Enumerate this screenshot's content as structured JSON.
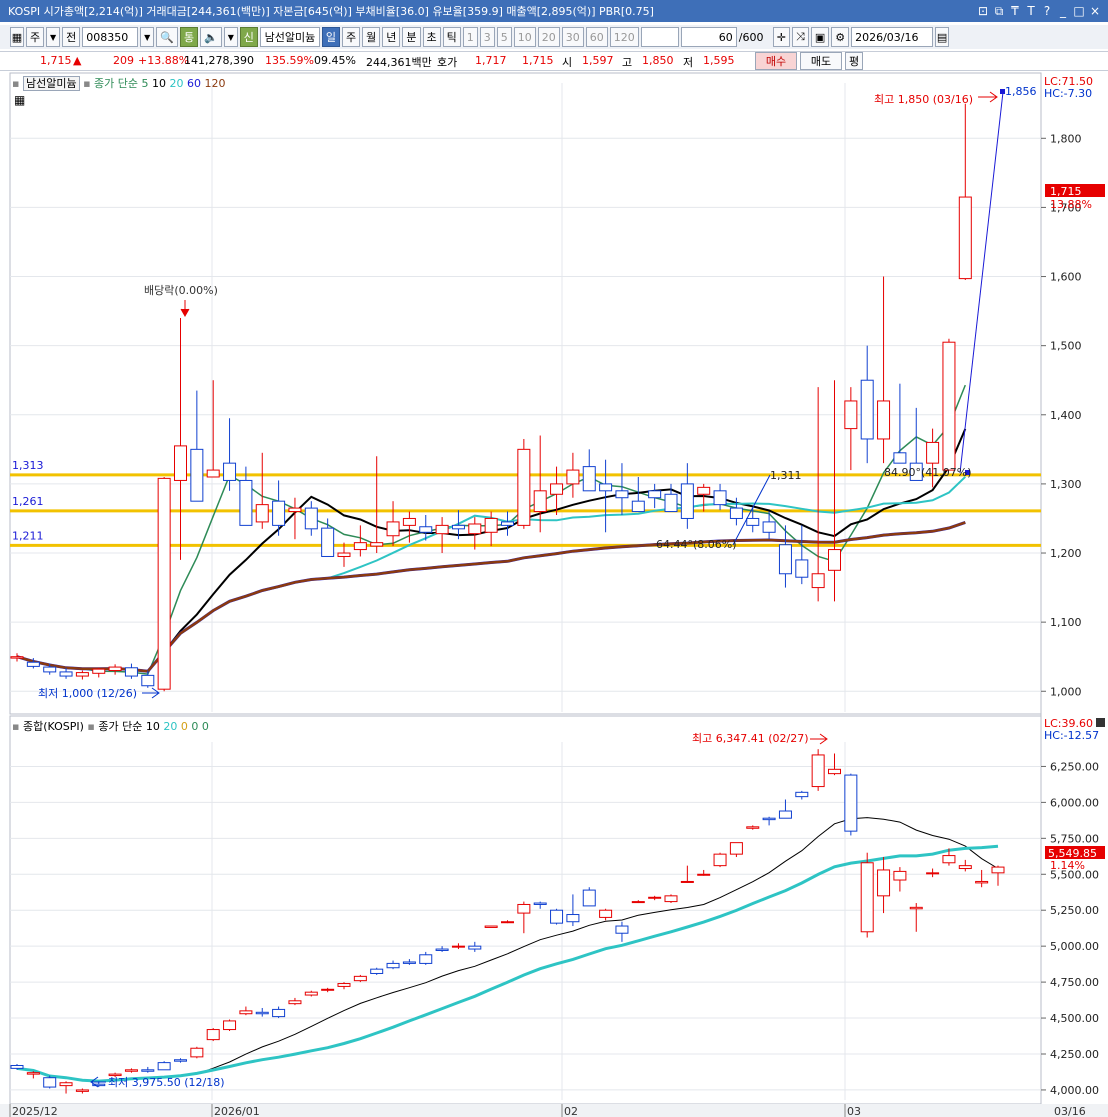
{
  "window": {
    "title": "KOSPI 시가총액[2,214(억)] 거래대금[244,361(백만)] 자본금[645(억)] 부채비율[36.0] 유보율[359.9] 매출액[2,895(억)] PBR[0.75]",
    "buttons": [
      "⊡",
      "⧉",
      "₸",
      "T",
      "?",
      "_",
      "□",
      "×"
    ]
  },
  "toolbar": {
    "market": "주",
    "scope": "전",
    "code": "008350",
    "search_icon": "🔍",
    "tong": "통",
    "sound_icon": "🔈",
    "sin": "신",
    "stock_name": "남선알미늄",
    "periods": [
      "일",
      "주",
      "월",
      "년",
      "분",
      "초",
      "틱"
    ],
    "intervals": [
      "1",
      "3",
      "5",
      "10",
      "20",
      "30",
      "60",
      "120"
    ],
    "count": "60",
    "count_total": "/600",
    "date": "2026/03/16"
  },
  "price": {
    "current": "1,715",
    "change": "209",
    "change_pct": "+13.88%",
    "volume": "141,278,390",
    "volume_ratio": "135.59%",
    "turnover": "09.45%",
    "amount": "244,361백만",
    "quote_label": "호가",
    "ask": "1,717",
    "bid": "1,715",
    "open_label": "시",
    "open": "1,597",
    "high_label": "고",
    "high": "1,850",
    "low_label": "저",
    "low": "1,595",
    "buy": "매수",
    "sell": "매도",
    "eval": "평"
  },
  "upper": {
    "legend_name": "남선알미늄",
    "ma_label": "종가 단순",
    "ma_periods": [
      "5",
      "10",
      "20",
      "60",
      "120"
    ],
    "ma_colors": [
      "#2e8b57",
      "#000000",
      "#2ec4c4",
      "#1a1ad6",
      "#8b3a0f"
    ],
    "lc": "LC:71.50",
    "hc": "HC:-7.30",
    "ylim": [
      970,
      1880
    ],
    "yticks": [
      1000,
      1100,
      1200,
      1300,
      1400,
      1500,
      1600,
      1700,
      1800
    ],
    "ytick_labels": [
      "1,000",
      "1,100",
      "1,200",
      "1,300",
      "1,400",
      "1,500",
      "1,600",
      "1,700",
      "1,800"
    ],
    "current_tag": "1,715",
    "current_pct": "13.88%",
    "hlines": [
      {
        "value": 1313,
        "label": "1,313"
      },
      {
        "value": 1261,
        "label": "1,261"
      },
      {
        "value": 1211,
        "label": "1,211"
      }
    ],
    "annotations": {
      "max": "최고 1,850 (03/16)",
      "min": "최저 1,000 (12/26)",
      "dividend": "배당락(0.00%)",
      "peak": "1,856",
      "t1": "1,311",
      "t2": "64.44°(8.06%)",
      "t3": "84.90°(41.07%)"
    }
  },
  "lower": {
    "legend_name": "종합(KOSPI)",
    "ma_label": "종가 단순",
    "ma_periods": [
      "10",
      "20",
      "0",
      "0",
      "0"
    ],
    "ma_colors": [
      "#000000",
      "#2ec4c4",
      "#d4a017",
      "#2e8b57",
      "#2e8b57"
    ],
    "lc": "LC:39.60",
    "hc": "HC:-12.57",
    "ylim": [
      3930,
      6420
    ],
    "yticks": [
      4000,
      4250,
      4500,
      4750,
      5000,
      5250,
      5500,
      5750,
      6000,
      6250
    ],
    "ytick_labels": [
      "4,000.00",
      "4,250.00",
      "4,500.00",
      "4,750.00",
      "5,000.00",
      "5,250.00",
      "5,500.00",
      "5,750.00",
      "6,000.00",
      "6,250.00"
    ],
    "current_tag": "5,549.85",
    "current_pct": "1.14%",
    "annotations": {
      "max": "최고 6,347.41 (02/27)",
      "min": "최저 3,975.50 (12/18)"
    }
  },
  "xaxis": {
    "labels": [
      "2025/12",
      "2026/01",
      "02",
      "03",
      "03/16"
    ]
  },
  "chart_data": [
    {
      "type": "candlestick",
      "title": "남선알미늄",
      "ylim": [
        970,
        1880
      ],
      "candles": [
        [
          1048,
          1055,
          1043,
          1050
        ],
        [
          1042,
          1048,
          1033,
          1036
        ],
        [
          1035,
          1040,
          1024,
          1028
        ],
        [
          1028,
          1034,
          1018,
          1022
        ],
        [
          1022,
          1030,
          1017,
          1027
        ],
        [
          1026,
          1034,
          1020,
          1032
        ],
        [
          1030,
          1039,
          1024,
          1035
        ],
        [
          1034,
          1040,
          1018,
          1022
        ],
        [
          1023,
          1030,
          1005,
          1008
        ],
        [
          1003,
          1310,
          1000,
          1308
        ],
        [
          1305,
          1540,
          1190,
          1355
        ],
        [
          1350,
          1435,
          1280,
          1275
        ],
        [
          1310,
          1450,
          1315,
          1320
        ],
        [
          1330,
          1395,
          1290,
          1305
        ],
        [
          1305,
          1325,
          1240,
          1240
        ],
        [
          1245,
          1345,
          1235,
          1270
        ],
        [
          1275,
          1305,
          1225,
          1240
        ],
        [
          1260,
          1280,
          1220,
          1265
        ],
        [
          1265,
          1275,
          1225,
          1235
        ],
        [
          1236,
          1250,
          1200,
          1195
        ],
        [
          1195,
          1215,
          1180,
          1200
        ],
        [
          1205,
          1240,
          1195,
          1215
        ],
        [
          1210,
          1340,
          1200,
          1215
        ],
        [
          1225,
          1275,
          1210,
          1245
        ],
        [
          1240,
          1260,
          1215,
          1250
        ],
        [
          1238,
          1255,
          1218,
          1230
        ],
        [
          1228,
          1252,
          1200,
          1240
        ],
        [
          1240,
          1262,
          1220,
          1235
        ],
        [
          1228,
          1252,
          1205,
          1242
        ],
        [
          1230,
          1260,
          1210,
          1250
        ],
        [
          1245,
          1260,
          1225,
          1240
        ],
        [
          1240,
          1365,
          1235,
          1350
        ],
        [
          1260,
          1370,
          1230,
          1290
        ],
        [
          1285,
          1325,
          1255,
          1300
        ],
        [
          1300,
          1345,
          1280,
          1320
        ],
        [
          1325,
          1350,
          1290,
          1290
        ],
        [
          1300,
          1335,
          1230,
          1290
        ],
        [
          1290,
          1330,
          1255,
          1280
        ],
        [
          1275,
          1310,
          1260,
          1260
        ],
        [
          1290,
          1300,
          1265,
          1280
        ],
        [
          1285,
          1300,
          1262,
          1260
        ],
        [
          1300,
          1330,
          1235,
          1250
        ],
        [
          1285,
          1300,
          1260,
          1295
        ],
        [
          1290,
          1300,
          1262,
          1270
        ],
        [
          1265,
          1280,
          1240,
          1250
        ],
        [
          1250,
          1265,
          1230,
          1240
        ],
        [
          1245,
          1260,
          1220,
          1230
        ],
        [
          1212,
          1240,
          1150,
          1170
        ],
        [
          1190,
          1240,
          1155,
          1165
        ],
        [
          1150,
          1440,
          1130,
          1170
        ],
        [
          1175,
          1450,
          1130,
          1205
        ],
        [
          1380,
          1440,
          1320,
          1420
        ],
        [
          1450,
          1500,
          1330,
          1365
        ],
        [
          1365,
          1600,
          1330,
          1420
        ],
        [
          1345,
          1445,
          1340,
          1330
        ],
        [
          1330,
          1410,
          1305,
          1305
        ],
        [
          1330,
          1380,
          1295,
          1360
        ],
        [
          1320,
          1510,
          1320,
          1505
        ],
        [
          1597,
          1850,
          1595,
          1715
        ]
      ]
    },
    {
      "type": "candlestick",
      "title": "종합(KOSPI)",
      "ylim": [
        3930,
        6420
      ],
      "candles": [
        [
          4170,
          4180,
          4140,
          4150
        ],
        [
          4110,
          4130,
          4080,
          4120
        ],
        [
          4085,
          4100,
          4010,
          4020
        ],
        [
          4030,
          4060,
          3975,
          4050
        ],
        [
          3990,
          4010,
          3975,
          4000
        ],
        [
          4040,
          4060,
          4020,
          4030
        ],
        [
          4100,
          4120,
          4090,
          4110
        ],
        [
          4130,
          4150,
          4120,
          4140
        ],
        [
          4140,
          4160,
          4120,
          4130
        ],
        [
          4190,
          4200,
          4140,
          4140
        ],
        [
          4210,
          4220,
          4190,
          4200
        ],
        [
          4230,
          4300,
          4220,
          4290
        ],
        [
          4350,
          4430,
          4340,
          4420
        ],
        [
          4420,
          4490,
          4410,
          4480
        ],
        [
          4530,
          4580,
          4520,
          4550
        ],
        [
          4540,
          4570,
          4510,
          4530
        ],
        [
          4560,
          4580,
          4500,
          4510
        ],
        [
          4600,
          4640,
          4590,
          4620
        ],
        [
          4660,
          4690,
          4650,
          4680
        ],
        [
          4700,
          4710,
          4680,
          4700
        ],
        [
          4720,
          4750,
          4700,
          4740
        ],
        [
          4760,
          4800,
          4750,
          4790
        ],
        [
          4840,
          4850,
          4800,
          4810
        ],
        [
          4880,
          4900,
          4840,
          4850
        ],
        [
          4890,
          4910,
          4870,
          4880
        ],
        [
          4940,
          4960,
          4870,
          4880
        ],
        [
          4980,
          5000,
          4960,
          4970
        ],
        [
          5000,
          5020,
          4980,
          5000
        ],
        [
          5000,
          5030,
          4960,
          4980
        ],
        [
          5130,
          5140,
          5130,
          5140
        ],
        [
          5170,
          5180,
          5160,
          5170
        ],
        [
          5230,
          5310,
          5090,
          5290
        ],
        [
          5300,
          5310,
          5260,
          5290
        ],
        [
          5250,
          5260,
          5150,
          5160
        ],
        [
          5220,
          5360,
          5140,
          5170
        ],
        [
          5390,
          5410,
          5280,
          5280
        ],
        [
          5200,
          5260,
          5180,
          5250
        ],
        [
          5140,
          5170,
          5030,
          5090
        ],
        [
          5310,
          5320,
          5300,
          5310
        ],
        [
          5340,
          5350,
          5320,
          5340
        ],
        [
          5310,
          5360,
          5300,
          5350
        ],
        [
          5450,
          5560,
          5440,
          5450
        ],
        [
          5500,
          5530,
          5490,
          5500
        ],
        [
          5560,
          5650,
          5550,
          5640
        ],
        [
          5640,
          5700,
          5620,
          5720
        ],
        [
          5820,
          5840,
          5810,
          5830
        ],
        [
          5890,
          5900,
          5840,
          5880
        ],
        [
          5940,
          6020,
          5920,
          5890
        ],
        [
          6070,
          6080,
          6020,
          6040
        ],
        [
          6110,
          6370,
          6080,
          6330
        ],
        [
          6200,
          6340,
          6190,
          6230
        ],
        [
          6190,
          6200,
          5770,
          5800
        ],
        [
          5100,
          5650,
          5060,
          5580
        ],
        [
          5350,
          5620,
          5230,
          5530
        ],
        [
          5460,
          5550,
          5380,
          5520
        ],
        [
          5260,
          5300,
          5100,
          5270
        ],
        [
          5510,
          5540,
          5480,
          5510
        ],
        [
          5580,
          5680,
          5560,
          5630
        ],
        [
          5540,
          5600,
          5520,
          5560
        ],
        [
          5440,
          5530,
          5410,
          5450
        ],
        [
          5510,
          5560,
          5420,
          5550
        ]
      ]
    }
  ]
}
